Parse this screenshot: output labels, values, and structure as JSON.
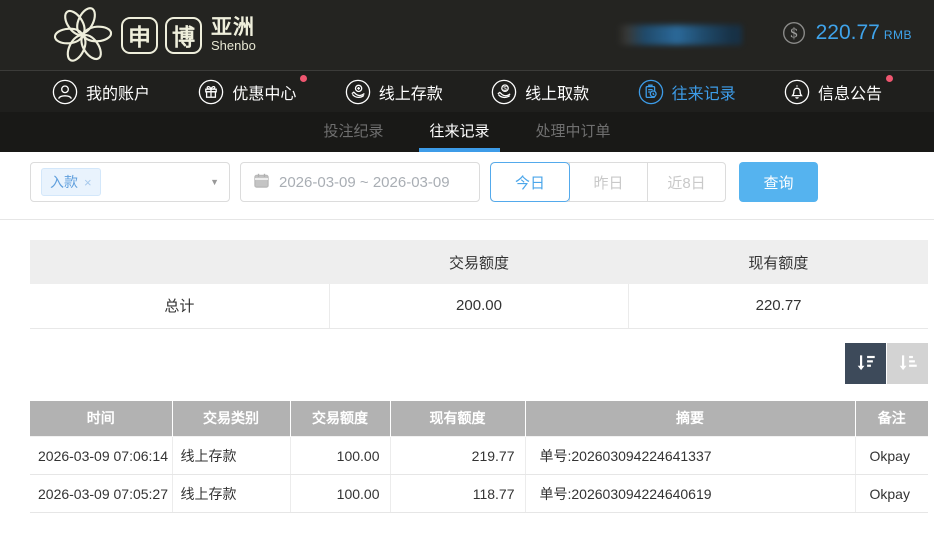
{
  "header": {
    "logo": {
      "char1": "申",
      "char2": "博",
      "region": "亚洲",
      "subtitle": "Shenbo"
    },
    "balance": {
      "amount": "220.77",
      "currency": "RMB"
    }
  },
  "nav": {
    "items": [
      {
        "label": "我的账户",
        "icon": "user-icon",
        "active": false,
        "badge": false
      },
      {
        "label": "优惠中心",
        "icon": "gift-icon",
        "active": false,
        "badge": true
      },
      {
        "label": "线上存款",
        "icon": "deposit-icon",
        "active": false,
        "badge": false
      },
      {
        "label": "线上取款",
        "icon": "withdraw-icon",
        "active": false,
        "badge": false
      },
      {
        "label": "往来记录",
        "icon": "records-icon",
        "active": true,
        "badge": false
      },
      {
        "label": "信息公告",
        "icon": "bell-icon",
        "active": false,
        "badge": true
      }
    ]
  },
  "subnav": {
    "tabs": [
      {
        "label": "投注纪录",
        "active": false
      },
      {
        "label": "往来记录",
        "active": true
      },
      {
        "label": "处理中订单",
        "active": false
      }
    ]
  },
  "filters": {
    "type_tag": "入款",
    "tag_remove": "×",
    "date_range": "2026-03-09 ~ 2026-03-09",
    "quick_buttons": [
      {
        "label": "今日",
        "active": true
      },
      {
        "label": "昨日",
        "active": false
      },
      {
        "label": "近8日",
        "active": false
      }
    ],
    "search_label": "查询"
  },
  "summary": {
    "headers": [
      "",
      "交易额度",
      "现有额度"
    ],
    "row": {
      "label": "总计",
      "transaction_amount": "200.00",
      "current_balance": "220.77"
    }
  },
  "sort": {
    "descending_active": true,
    "ascending_active": false
  },
  "records": {
    "headers": [
      "时间",
      "交易类别",
      "交易额度",
      "现有额度",
      "摘要",
      "备注"
    ],
    "rows": [
      [
        "2026-03-09 07:06:14",
        "线上存款",
        "100.00",
        "219.77",
        "单号:202603094224641337",
        "Okpay"
      ],
      [
        "2026-03-09 07:05:27",
        "线上存款",
        "100.00",
        "118.77",
        "单号:202603094224640619",
        "Okpay"
      ]
    ]
  },
  "colors": {
    "topbar_bg": "#242421",
    "nav_bg": "#1f1f1d",
    "subnav_bg": "#191917",
    "accent_blue": "#3d9ce8",
    "button_blue": "#55b3ef",
    "balance_blue": "#3fa3ea",
    "badge_red": "#ef5670",
    "logo_cream": "#eeeedb",
    "summary_header_bg": "#eeeeee",
    "records_header_bg": "#b2b2b2",
    "sort_active_bg": "#3d4a5a",
    "sort_inactive_bg": "#d3d3d3"
  }
}
